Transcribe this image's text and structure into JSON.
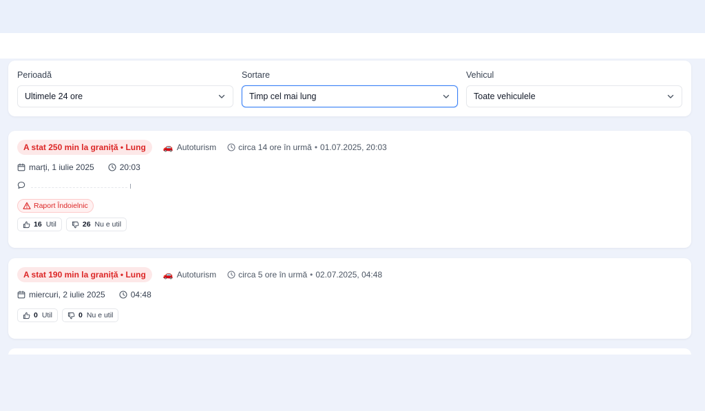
{
  "filters": {
    "period": {
      "label": "Perioadă",
      "value": "Ultimele 24 ore"
    },
    "sort": {
      "label": "Sortare",
      "value": "Timp cel mai lung"
    },
    "vehicle": {
      "label": "Vehicul",
      "value": "Toate vehiculele"
    }
  },
  "reports": [
    {
      "badge": "A stat 250 min la graniță • Lung",
      "vehicle": "Autoturism",
      "relative_time": "circa 14 ore în urmă",
      "timestamp": "01.07.2025, 20:03",
      "date": "marți, 1 iulie 2025",
      "time": "20:03",
      "warning": "Raport Îndoielnic",
      "helpful_count": "16",
      "helpful_label": "Util",
      "not_helpful_count": "26",
      "not_helpful_label": "Nu e util"
    },
    {
      "badge": "A stat 190 min la graniță • Lung",
      "vehicle": "Autoturism",
      "relative_time": "circa 5 ore în urmă",
      "timestamp": "02.07.2025, 04:48",
      "date": "miercuri, 2 iulie 2025",
      "time": "04:48",
      "helpful_count": "0",
      "helpful_label": "Util",
      "not_helpful_count": "0",
      "not_helpful_label": "Nu e util"
    }
  ],
  "icons": {
    "vehicle": "car-icon",
    "clock": "clock-icon",
    "calendar": "calendar-icon",
    "comment": "comment-icon",
    "warning": "warning-icon",
    "thumbs_up": "thumbs-up-icon",
    "thumbs_down": "thumbs-down-icon",
    "chevron": "chevron-down-icon"
  },
  "colors": {
    "accent": "#3b82f6",
    "danger": "#dc2626",
    "danger_bg": "#fde8e8"
  }
}
